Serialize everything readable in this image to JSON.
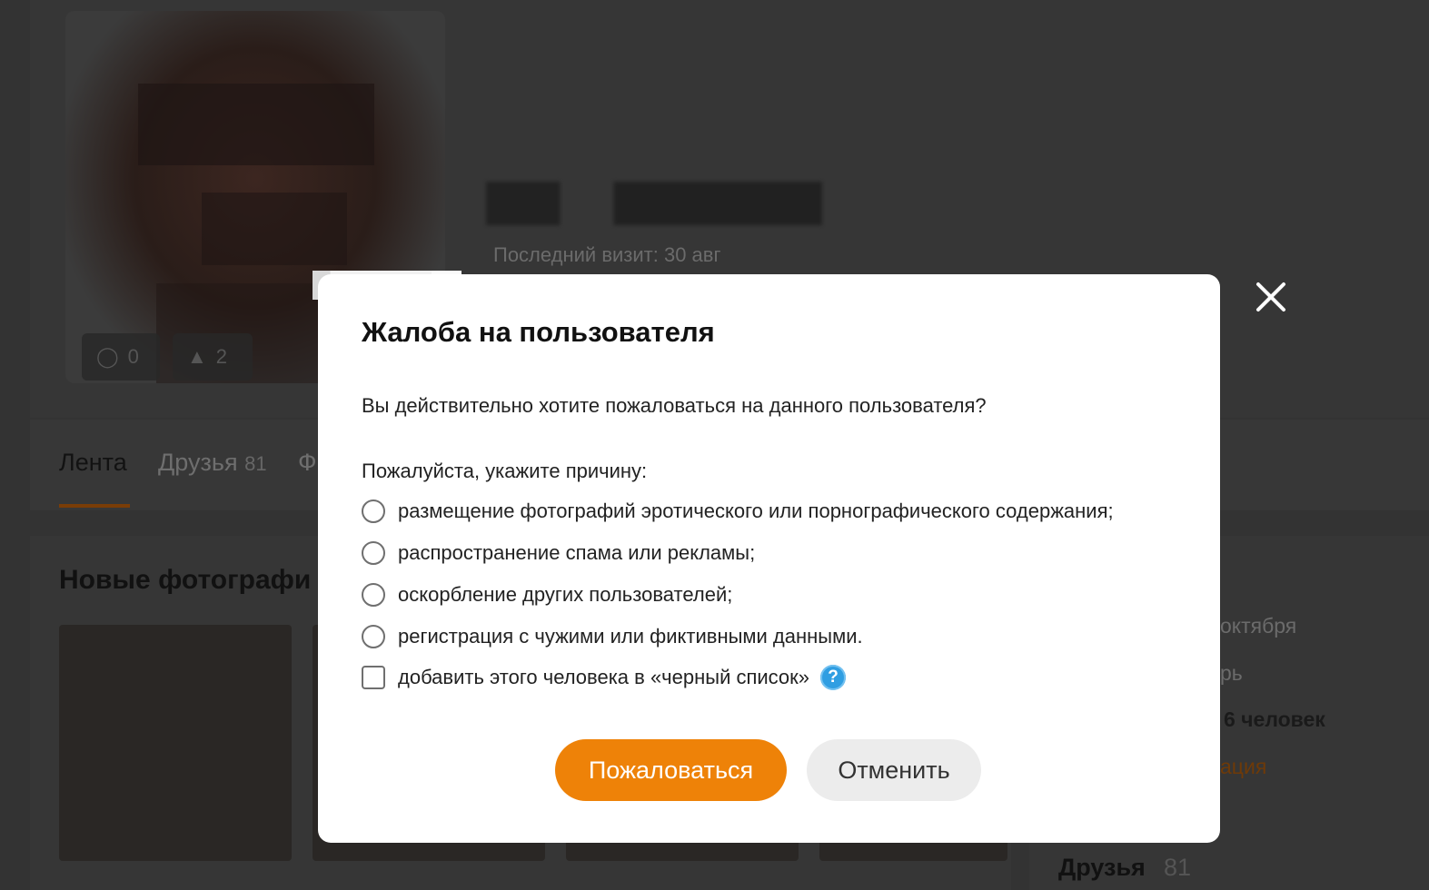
{
  "background": {
    "last_visit": "Последний визит: 30 авг",
    "avatar_stats": {
      "comments": "0",
      "likes": "2"
    },
    "tabs": [
      {
        "label": "Лента",
        "count": ""
      },
      {
        "label": "Друзья",
        "count": "81"
      },
      {
        "label": "Ф",
        "count": ""
      }
    ],
    "new_photos_title": "Новые фотографи",
    "side_info": [
      "октября",
      "рь",
      "6 человек",
      "ация"
    ],
    "friends": {
      "label": "Друзья",
      "count": "81"
    }
  },
  "modal": {
    "title": "Жалоба на пользователя",
    "question": "Вы действительно хотите пожаловаться на данного пользователя?",
    "prompt": "Пожалуйста, укажите причину:",
    "reasons": [
      "размещение фотографий эротического или порнографического содержания;",
      "распространение спама или рекламы;",
      "оскорбление других пользователей;",
      "регистрация с чужими или фиктивными данными."
    ],
    "blacklist_label": "добавить этого человека в «черный список»",
    "help_glyph": "?",
    "submit_label": "Пожаловаться",
    "cancel_label": "Отменить"
  },
  "icons": {
    "close": "close-icon",
    "help": "help-icon",
    "comment": "comment-icon",
    "like": "thumbs-up-icon"
  },
  "colors": {
    "accent": "#ee8208",
    "help": "#2f9ee2",
    "overlay": "#333333"
  }
}
